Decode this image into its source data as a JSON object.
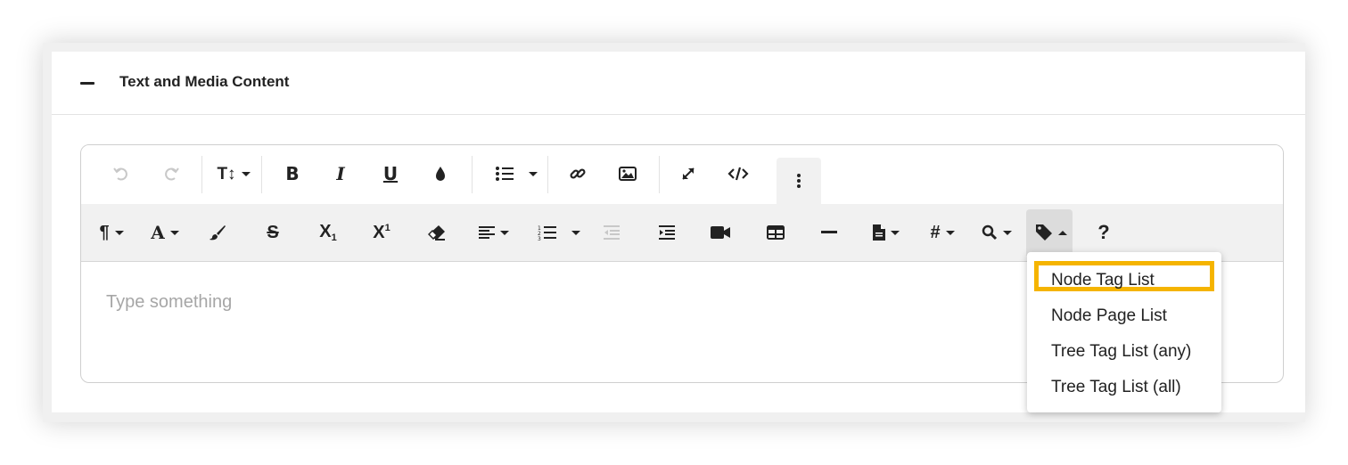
{
  "panel": {
    "title": "Text and Media Content"
  },
  "toolbar": {
    "row1": [
      {
        "name": "undo-icon",
        "disabled": true
      },
      {
        "name": "redo-icon",
        "disabled": true
      },
      {
        "name": "font-size-icon",
        "dropdown": true
      },
      {
        "name": "bold-icon"
      },
      {
        "name": "italic-icon"
      },
      {
        "name": "underline-icon"
      },
      {
        "name": "text-color-icon"
      },
      {
        "name": "unordered-list-icon",
        "dropdown": true
      },
      {
        "name": "link-icon"
      },
      {
        "name": "image-icon"
      },
      {
        "name": "fullscreen-icon"
      },
      {
        "name": "code-view-icon"
      },
      {
        "name": "more-icon"
      }
    ],
    "row2": [
      {
        "name": "paragraph-format-icon",
        "dropdown": true
      },
      {
        "name": "font-family-icon",
        "dropdown": true
      },
      {
        "name": "paint-brush-icon"
      },
      {
        "name": "strikethrough-icon"
      },
      {
        "name": "subscript-icon"
      },
      {
        "name": "superscript-icon"
      },
      {
        "name": "clear-formatting-icon"
      },
      {
        "name": "align-icon",
        "dropdown": true
      },
      {
        "name": "ordered-list-icon",
        "dropdown": true
      },
      {
        "name": "outdent-icon",
        "disabled": true
      },
      {
        "name": "indent-icon"
      },
      {
        "name": "video-icon"
      },
      {
        "name": "table-icon"
      },
      {
        "name": "horizontal-line-icon"
      },
      {
        "name": "document-icon",
        "dropdown": true
      },
      {
        "name": "hashtag-icon",
        "dropdown": true
      },
      {
        "name": "search-icon",
        "dropdown": true
      },
      {
        "name": "tag-icon",
        "dropdown": true,
        "open": true
      },
      {
        "name": "help-icon"
      }
    ]
  },
  "editor": {
    "placeholder": "Type something"
  },
  "tag_menu": {
    "items": [
      {
        "label": "Node Tag List",
        "highlighted": true
      },
      {
        "label": "Node Page List"
      },
      {
        "label": "Tree Tag List (any)"
      },
      {
        "label": "Tree Tag List (all)"
      }
    ]
  },
  "colors": {
    "highlight": "#f5b400",
    "toolbar_bg": "#f1f1f1",
    "placeholder": "#a6a6a6",
    "disabled_icon": "#c8c8c8"
  }
}
